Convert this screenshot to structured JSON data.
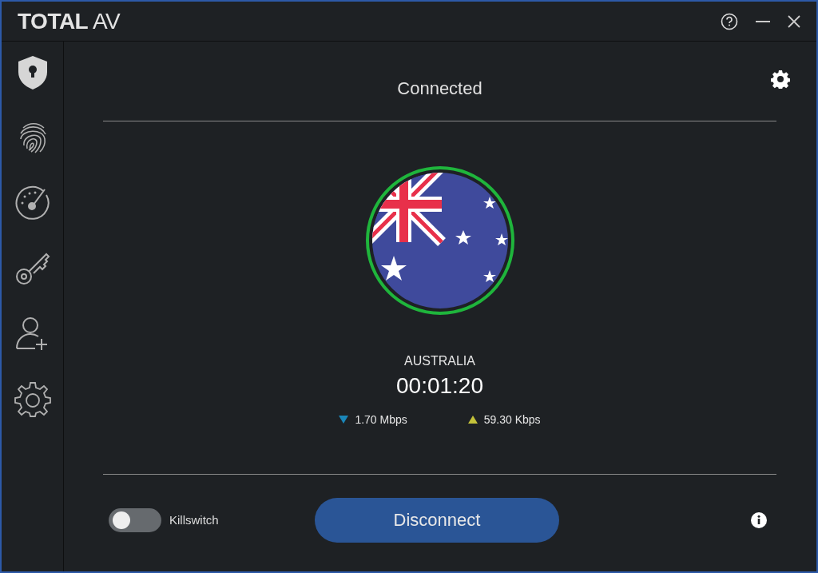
{
  "window": {
    "logo": "**TOTAL** AV"
  },
  "sidebar": {
    "items": [
      {
        "kind": "shield",
        "selected": true
      },
      {
        "kind": "fingerprint",
        "selected": false
      },
      {
        "kind": "speedometer",
        "selected": false
      },
      {
        "kind": "key",
        "selected": false
      },
      {
        "kind": "add-user",
        "selected": false
      },
      {
        "kind": "settings",
        "selected": false
      }
    ]
  },
  "vpn": {
    "status": "Connected",
    "connected": true,
    "country": "AUSTRALIA",
    "duration": "00:01:20",
    "download": "1.70 Mbps",
    "upload": "59.30 Kbps"
  },
  "footer": {
    "killswitch": {
      "label": "Killswitch",
      "on": false
    },
    "button": "Disconnect"
  }
}
